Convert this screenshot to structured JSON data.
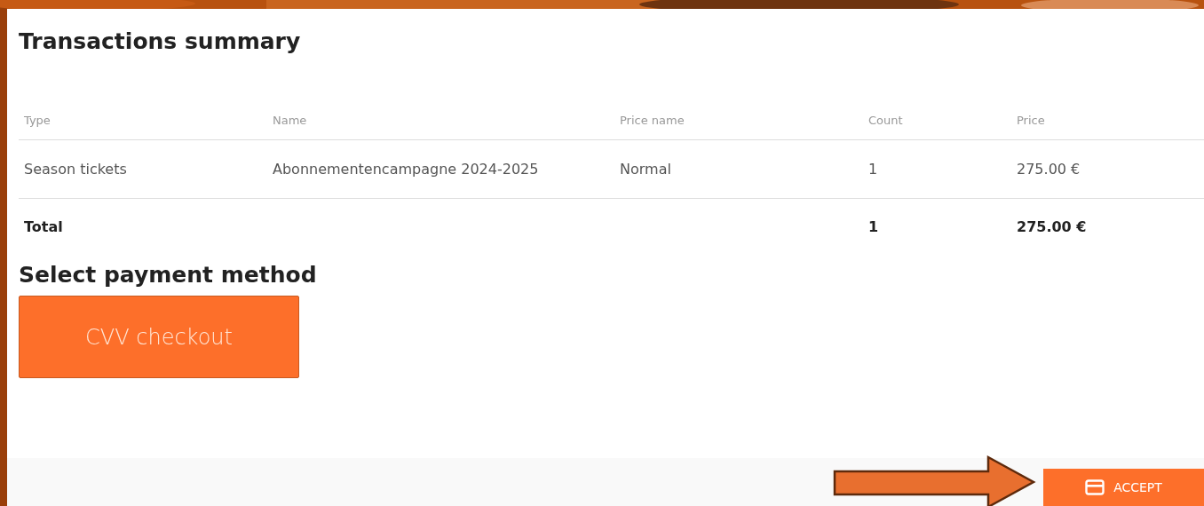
{
  "summary": {
    "title": "Transactions summary",
    "columns": [
      "Type",
      "Name",
      "Price name",
      "Count",
      "Price"
    ],
    "rows": [
      [
        "Season tickets",
        "Abonnementencampagne 2024-2025",
        "Normal",
        "1",
        "275.00 €"
      ]
    ],
    "total": {
      "label": "Total",
      "count": "1",
      "price": "275.00 €"
    }
  },
  "payment": {
    "title": "Select payment method",
    "methods": [
      {
        "label": "CVV checkout"
      }
    ]
  },
  "footer": {
    "accept": "ACCEPT"
  }
}
